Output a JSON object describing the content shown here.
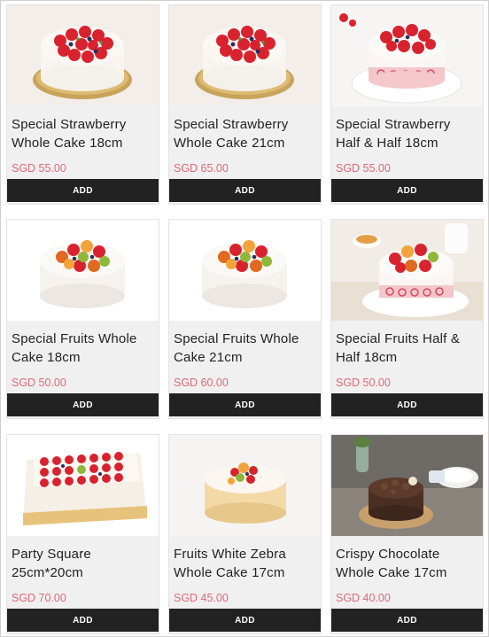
{
  "products": [
    {
      "name_line1": "Special Strawberry",
      "name_line2": "Whole Cake 18cm",
      "price": "SGD 55.00",
      "button": "ADD"
    },
    {
      "name_line1": "Special Strawberry",
      "name_line2": "Whole Cake 21cm",
      "price": "SGD 65.00",
      "button": "ADD"
    },
    {
      "name_line1": "Special Strawberry",
      "name_line2": "Half & Half 18cm",
      "price": "SGD 55.00",
      "button": "ADD"
    },
    {
      "name_line1": "Special Fruits Whole",
      "name_line2": "Cake 18cm",
      "price": "SGD 50.00",
      "button": "ADD"
    },
    {
      "name_line1": "Special Fruits Whole",
      "name_line2": "Cake 21cm",
      "price": "SGD 60.00",
      "button": "ADD"
    },
    {
      "name_line1": "Special Fruits Half &",
      "name_line2": "Half 18cm",
      "price": "SGD 50.00",
      "button": "ADD"
    },
    {
      "name_line1": "Party Square",
      "name_line2": "25cm*20cm",
      "price": "SGD 70.00",
      "button": "ADD"
    },
    {
      "name_line1": "Fruits White Zebra",
      "name_line2": "Whole Cake 17cm",
      "price": "SGD 45.00",
      "button": "ADD"
    },
    {
      "name_line1": "Crispy Chocolate",
      "name_line2": "Whole Cake 17cm",
      "price": "SGD 40.00",
      "button": "ADD"
    }
  ],
  "colors": {
    "price": "#e0677a",
    "button_bg": "#222222",
    "card_bg": "#f0f0f0"
  }
}
